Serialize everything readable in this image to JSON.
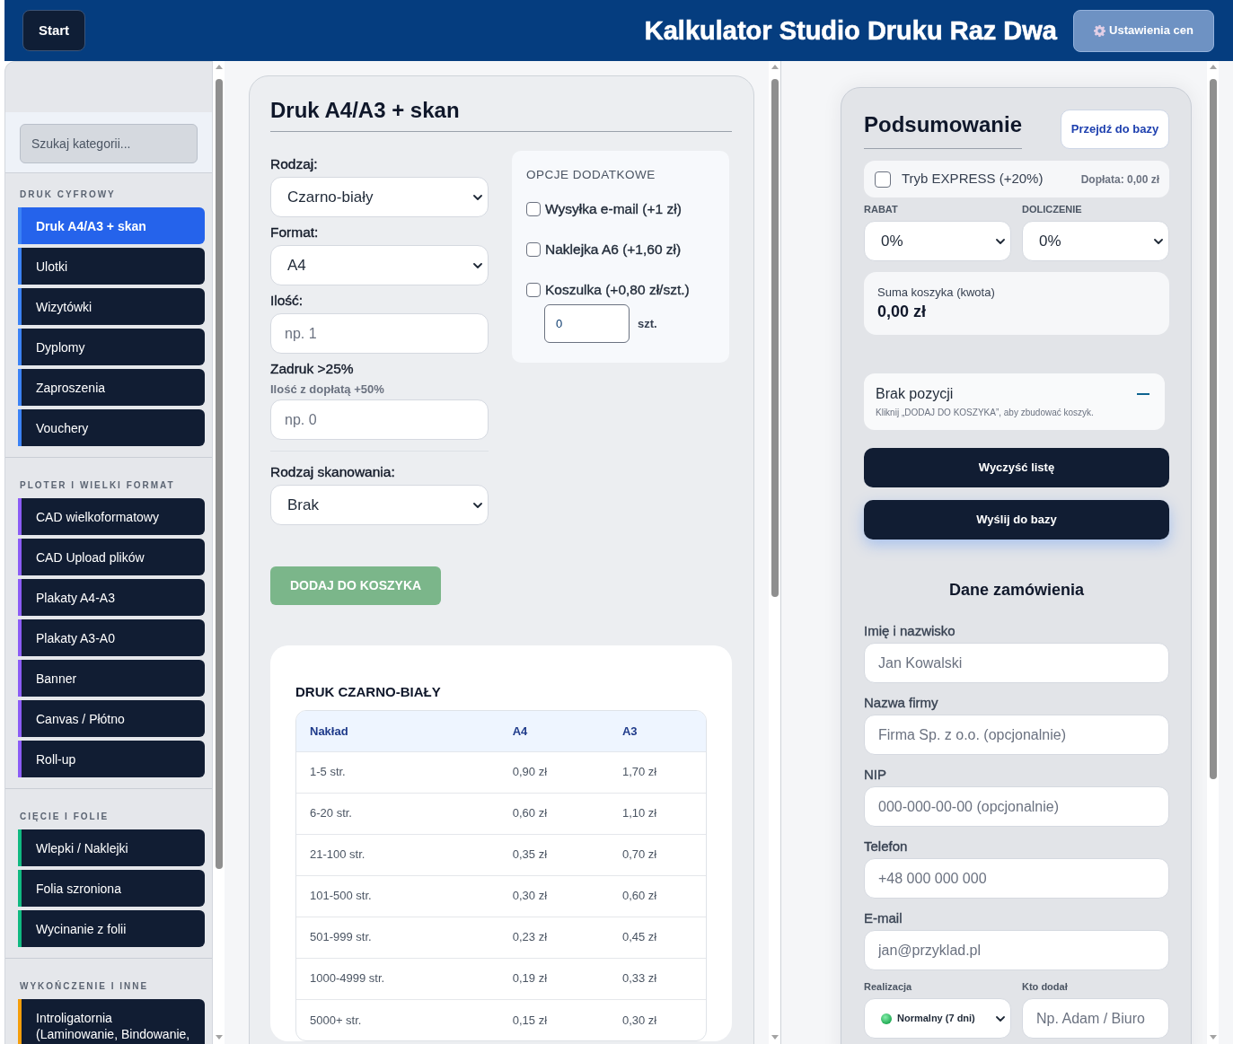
{
  "header": {
    "start_button": "Start",
    "title": "Kalkulator Studio Druku Raz Dwa",
    "settings_button": "Ustawienia cen"
  },
  "sidebar": {
    "search": {
      "placeholder": "Szukaj kategorii..."
    },
    "sections": [
      {
        "title": "DRUK CYFROWY",
        "color": "#3b82f6",
        "items": [
          {
            "label": "Druk A4/A3 + skan",
            "selected": true
          },
          {
            "label": "Ulotki",
            "selected": false
          },
          {
            "label": "Wizytówki",
            "selected": false
          },
          {
            "label": "Dyplomy",
            "selected": false
          },
          {
            "label": "Zaproszenia",
            "selected": false
          },
          {
            "label": "Vouchery",
            "selected": false
          }
        ]
      },
      {
        "title": "PLOTER I WIELKI FORMAT",
        "color": "#8b5cf6",
        "items": [
          {
            "label": "CAD wielkoformatowy",
            "selected": false
          },
          {
            "label": "CAD Upload plików",
            "selected": false
          },
          {
            "label": "Plakaty A4-A3",
            "selected": false
          },
          {
            "label": "Plakaty A3-A0",
            "selected": false
          },
          {
            "label": "Banner",
            "selected": false
          },
          {
            "label": "Canvas / Płótno",
            "selected": false
          },
          {
            "label": "Roll-up",
            "selected": false
          }
        ]
      },
      {
        "title": "CIĘCIE I FOLIE",
        "color": "#10b981",
        "items": [
          {
            "label": "Wlepki / Naklejki",
            "selected": false
          },
          {
            "label": "Folia szroniona",
            "selected": false
          },
          {
            "label": "Wycinanie z folii",
            "selected": false
          }
        ]
      },
      {
        "title": "WYKOŃCZENIE I INNE",
        "color": "#f59e0b",
        "items": [
          {
            "label": "Introligatornia (Laminowanie, Bindowanie,",
            "selected": false
          }
        ]
      }
    ]
  },
  "calculator": {
    "title": "Druk A4/A3 + skan",
    "fields": [
      {
        "kind": "select",
        "label": "Rodzaj:",
        "value": "Czarno-biały"
      },
      {
        "kind": "select",
        "label": "Format:",
        "value": "A4"
      },
      {
        "kind": "input",
        "label": "Ilość:",
        "placeholder": "np. 1"
      },
      {
        "kind": "input",
        "label": "Zadruk >25%",
        "hint": "Ilość z dopłatą +50%",
        "placeholder": "np. 0"
      }
    ],
    "scan_fields": [
      {
        "kind": "select",
        "label": "Rodzaj skanowania:",
        "value": "Brak"
      }
    ],
    "options": {
      "title": "OPCJE DODATKOWE",
      "items": [
        {
          "label": "Wysyłka e-mail (+1 zł)",
          "checked": false
        },
        {
          "label": "Naklejka A6 (+1,60 zł)",
          "checked": false
        },
        {
          "label": "Koszulka (+0,80 zł/szt.)",
          "checked": false,
          "quantity": {
            "value": "0",
            "unit": "szt."
          }
        }
      ]
    },
    "add_button": "DODAJ DO KOSZYKA",
    "price_table": {
      "title": "DRUK CZARNO-BIAŁY",
      "columns": [
        "Nakład",
        "A4",
        "A3"
      ],
      "rows": [
        [
          "1-5 str.",
          "0,90 zł",
          "1,70 zł"
        ],
        [
          "6-20 str.",
          "0,60 zł",
          "1,10 zł"
        ],
        [
          "21-100 str.",
          "0,35 zł",
          "0,70 zł"
        ],
        [
          "101-500 str.",
          "0,30 zł",
          "0,60 zł"
        ],
        [
          "501-999 str.",
          "0,23 zł",
          "0,45 zł"
        ],
        [
          "1000-4999 str.",
          "0,19 zł",
          "0,33 zł"
        ],
        [
          "5000+ str.",
          "0,15 zł",
          "0,30 zł"
        ]
      ]
    }
  },
  "summary": {
    "title": "Podsumowanie",
    "database_button": "Przejdź do bazy",
    "express": {
      "label": "Tryb EXPRESS (+20%)",
      "checked": false,
      "surcharge": "Dopłata: 0,00 zł"
    },
    "adjustments": [
      {
        "label": "RABAT",
        "value": "0%"
      },
      {
        "label": "DOLICZENIE",
        "value": "0%"
      }
    ],
    "total": {
      "label": "Suma koszyka (kwota)",
      "value": "0,00 zł"
    },
    "cart": {
      "empty_title": "Brak pozycji",
      "empty_hint": "Kliknij „DODAJ DO KOSZYKA”, aby zbudować koszyk."
    },
    "buttons": [
      {
        "kind": "clear",
        "label": "Wyczyść listę"
      },
      {
        "kind": "send",
        "label": "Wyślij do bazy"
      }
    ]
  },
  "order": {
    "title": "Dane zamówienia",
    "fields": [
      {
        "kind": "input",
        "label": "Imię i nazwisko",
        "placeholder": "Jan Kowalski"
      },
      {
        "kind": "input",
        "label": "Nazwa firmy",
        "placeholder": "Firma Sp. z o.o. (opcjonalnie)"
      },
      {
        "kind": "input",
        "label": "NIP",
        "placeholder": "000-000-00-00 (opcjonalnie)"
      },
      {
        "kind": "input",
        "label": "Telefon",
        "placeholder": "+48 000 000 000"
      },
      {
        "kind": "input",
        "label": "E-mail",
        "placeholder": "jan@przyklad.pl"
      }
    ],
    "details_row": [
      {
        "kind": "select",
        "label": "Realizacja",
        "value": "Normalny (7 dni)"
      },
      {
        "kind": "input",
        "label": "Kto dodał",
        "placeholder": "Np. Adam / Biuro"
      }
    ]
  }
}
